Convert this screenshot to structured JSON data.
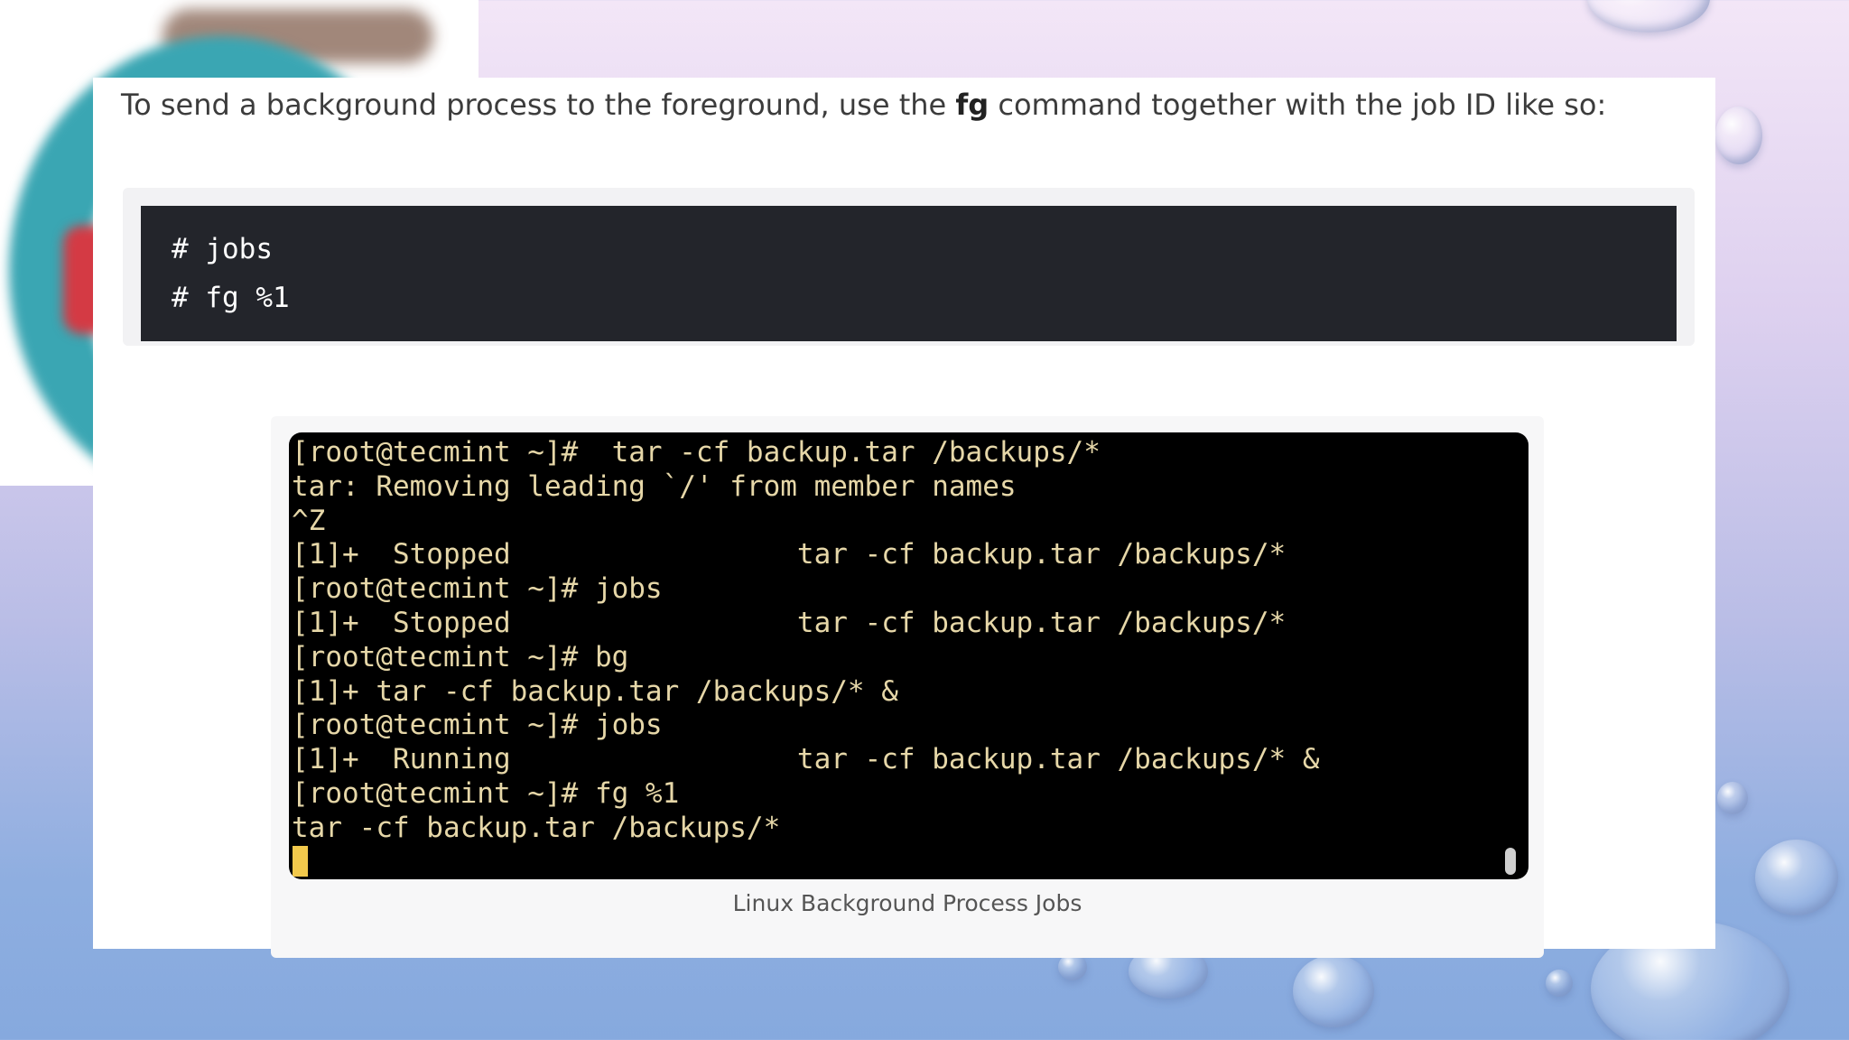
{
  "article": {
    "intro_before": "To send a background process to the foreground, use the ",
    "intro_bold": "fg",
    "intro_after": " command together with the job ID like so:"
  },
  "code_block": {
    "lines": [
      "# jobs",
      "# fg %1"
    ]
  },
  "terminal": {
    "lines": [
      "[root@tecmint ~]#  tar -cf backup.tar /backups/*",
      "tar: Removing leading `/' from member names",
      "^Z",
      "[1]+  Stopped                 tar -cf backup.tar /backups/*",
      "[root@tecmint ~]# jobs",
      "[1]+  Stopped                 tar -cf backup.tar /backups/*",
      "[root@tecmint ~]# bg",
      "[1]+ tar -cf backup.tar /backups/* &",
      "[root@tecmint ~]# jobs",
      "[1]+  Running                 tar -cf backup.tar /backups/* &",
      "[root@tecmint ~]# fg %1",
      "tar -cf backup.tar /backups/*"
    ],
    "text_color": "#e6d7a8",
    "cursor_color": "#f2c94c"
  },
  "figure": {
    "caption": "Linux Background Process Jobs"
  }
}
